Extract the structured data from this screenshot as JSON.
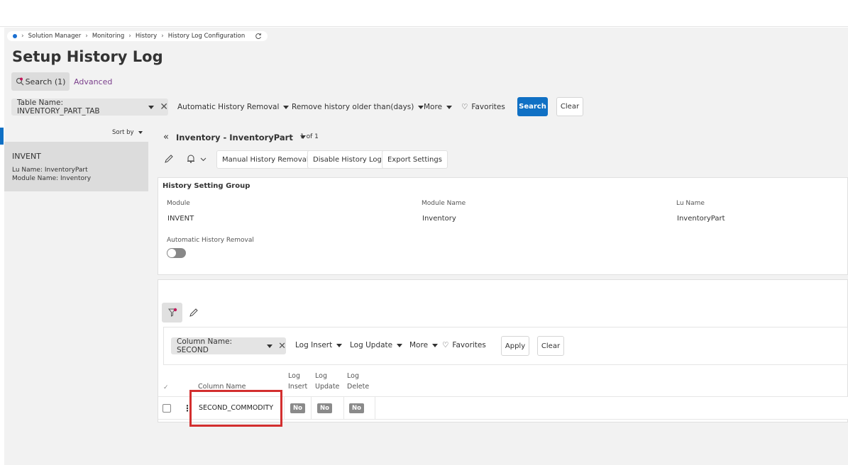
{
  "breadcrumb": {
    "items": [
      "Solution Manager",
      "Monitoring",
      "History",
      "History Log Configuration"
    ]
  },
  "page": {
    "title": "Setup History Log"
  },
  "search": {
    "toggle_label": "Search (1)",
    "advanced_label": "Advanced",
    "filters": {
      "table_name": "Table Name: INVENTORY_PART_TAB",
      "automatic_removal": "Automatic History Removal",
      "remove_older": "Remove history older than(days)",
      "more": "More",
      "favorites": "Favorites"
    },
    "search_button": "Search",
    "clear_button": "Clear"
  },
  "list": {
    "sort_by": "Sort by",
    "item": {
      "title": "INVENT",
      "lu_name": "Lu Name:  InventoryPart",
      "module_name": "Module Name:  Inventory"
    }
  },
  "record": {
    "header": "Inventory - InventoryPart",
    "count": "1 of 1",
    "actions": {
      "manual_removal": "Manual History Removal",
      "disable_log": "Disable History Log",
      "export_settings": "Export Settings"
    }
  },
  "group": {
    "title": "History Setting Group",
    "fields": {
      "module_label": "Module",
      "module_value": "INVENT",
      "module_name_label": "Module Name",
      "module_name_value": "Inventory",
      "lu_name_label": "Lu Name",
      "lu_name_value": "InventoryPart",
      "auto_removal_label": "Automatic History Removal"
    },
    "auto_removal_on": false
  },
  "sub_filter": {
    "column_name": "Column Name: SECOND",
    "log_insert": "Log Insert",
    "log_update": "Log Update",
    "more": "More",
    "favorites": "Favorites",
    "apply_button": "Apply",
    "clear_button": "Clear"
  },
  "grid": {
    "headers": {
      "column_name": "Column Name",
      "log_insert_1": "Log",
      "log_insert_2": "Insert",
      "log_update_1": "Log",
      "log_update_2": "Update",
      "log_delete_1": "Log",
      "log_delete_2": "Delete"
    },
    "rows": [
      {
        "column_name": "SECOND_COMMODITY",
        "log_insert": "No",
        "log_update": "No",
        "log_delete": "No"
      }
    ]
  },
  "colors": {
    "accent": "#1070c4",
    "highlight": "#d32f2f",
    "advanced_link": "#7b3f8c"
  }
}
